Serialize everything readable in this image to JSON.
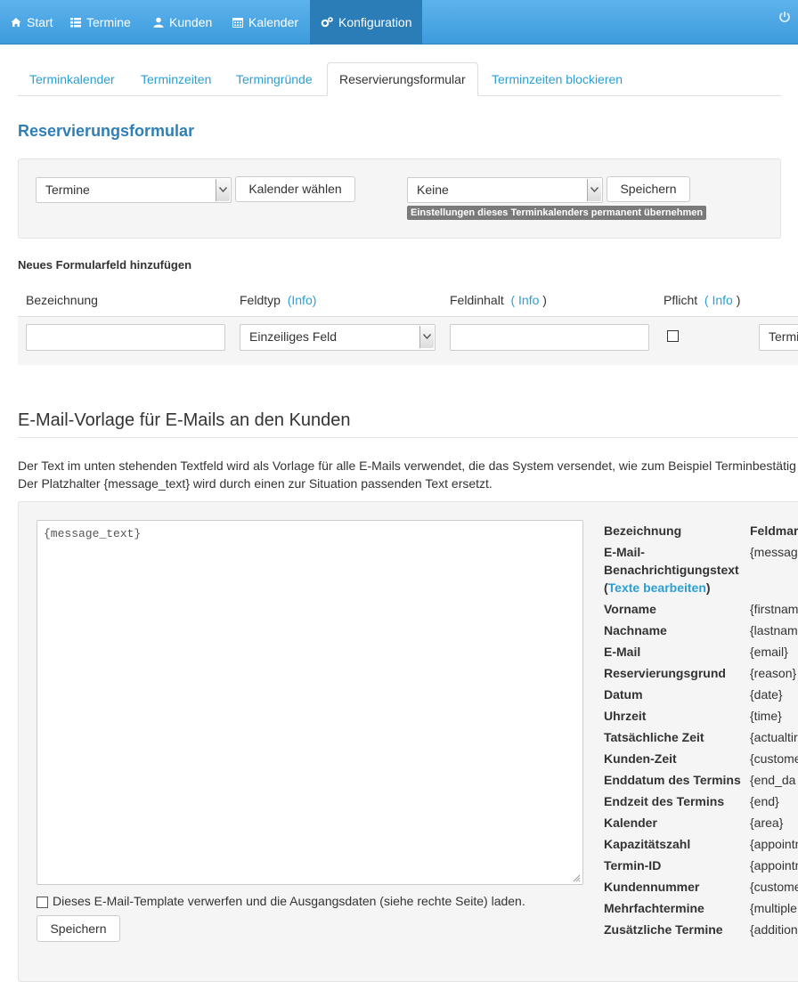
{
  "nav": {
    "items": [
      {
        "label": "Start",
        "icon": "home-icon"
      },
      {
        "label": "Termine",
        "icon": "list-icon"
      },
      {
        "label": "Kunden",
        "icon": "user-icon"
      },
      {
        "label": "Kalender",
        "icon": "calendar-icon"
      },
      {
        "label": "Konfiguration",
        "icon": "cogs-icon",
        "active": true
      }
    ],
    "power_icon": "power-icon"
  },
  "tabs": [
    {
      "label": "Terminkalender"
    },
    {
      "label": "Terminzeiten"
    },
    {
      "label": "Termingründe"
    },
    {
      "label": "Reservierungsformular",
      "active": true
    },
    {
      "label": "Terminzeiten blockieren"
    }
  ],
  "section_title": "Reservierungsformular",
  "calendar_select": {
    "value": "Termine",
    "button": "Kalender wählen"
  },
  "copy_select": {
    "value": "Keine",
    "button": "Speichern",
    "badge": "Einstellungen dieses Terminkalenders permanent übernehmen"
  },
  "new_field": {
    "heading": "Neues Formularfeld hinzufügen",
    "columns": {
      "bezeichnung": "Bezeichnung",
      "feldtyp": "Feldtyp",
      "feldinhalt": "Feldinhalt",
      "pflicht": "Pflicht",
      "info": "Info",
      "paren_open": "(",
      "paren_close": ")"
    },
    "feldtyp_value": "Einzeiliges Feld",
    "bezeichnung_value": "",
    "feldinhalt_value": "",
    "extra_select_value": "Termi"
  },
  "email_template": {
    "heading": "E-Mail-Vorlage für E-Mails an den Kunden",
    "description_line1": "Der Text im unten stehenden Textfeld wird als Vorlage für alle E-Mails verwendet, die das System versendet, wie zum Beispiel Terminbestätig",
    "description_line2": "Der Platzhalter {message_text} wird durch einen zur Situation passenden Text ersetzt.",
    "textarea_value": "{message_text}",
    "discard_label": "Dieses E-Mail-Template verwerfen und die Ausgangsdaten (siehe rechte Seite) laden.",
    "save_button": "Speichern"
  },
  "placeholders": {
    "header_label": "Bezeichnung",
    "header_value": "Feldmar",
    "notification_label_1": "E-Mail-",
    "notification_label_2": "Benachrichtigungstext",
    "notification_link_open": "(",
    "notification_link": "Texte bearbeiten",
    "notification_link_close": ")",
    "notification_value": "{messag",
    "rows": [
      {
        "label": "Vorname",
        "value": "{firstnam"
      },
      {
        "label": "Nachname",
        "value": "{lastnam"
      },
      {
        "label": "E-Mail",
        "value": "{email}"
      },
      {
        "label": "Reservierungsgrund",
        "value": "{reason}"
      },
      {
        "label": "Datum",
        "value": "{date}"
      },
      {
        "label": "Uhrzeit",
        "value": "{time}"
      },
      {
        "label": "Tatsächliche Zeit",
        "value": "{actualtir"
      },
      {
        "label": "Kunden-Zeit",
        "value": "{custome"
      },
      {
        "label": "Enddatum des Termins",
        "value": "{end_da"
      },
      {
        "label": "Endzeit des Termins",
        "value": "{end}"
      },
      {
        "label": "Kalender",
        "value": "{area}"
      },
      {
        "label": "Kapazitätszahl",
        "value": "{appointn"
      },
      {
        "label": "Termin-ID",
        "value": "{appointn"
      },
      {
        "label": "Kundennummer",
        "value": "{custome"
      },
      {
        "label": "Mehrfachtermine",
        "value": "{multiple"
      },
      {
        "label": "Zusätzliche Termine",
        "value": "{addition"
      }
    ]
  }
}
